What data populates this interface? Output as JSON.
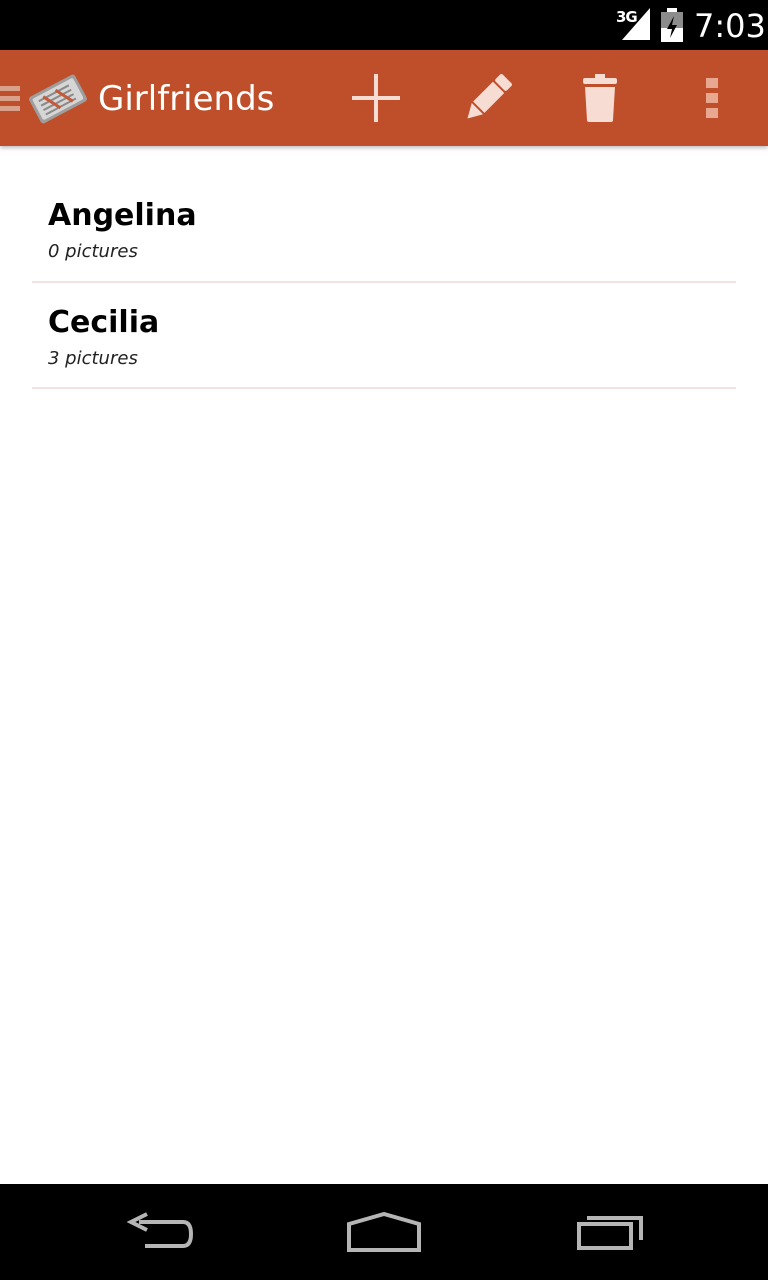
{
  "status_bar": {
    "network_label": "3G",
    "time": "7:03",
    "icons": [
      "signal-icon",
      "battery-charging-icon"
    ]
  },
  "action_bar": {
    "title": "Girlfriends",
    "background_color": "#bf4f2a",
    "icons": [
      "drawer-indicator-icon",
      "app-logo-icon",
      "add-icon",
      "edit-pencil-icon",
      "trash-icon",
      "overflow-menu-icon"
    ]
  },
  "list": {
    "items": [
      {
        "name": "Angelina",
        "subtitle": "0 pictures"
      },
      {
        "name": "Cecilia",
        "subtitle": "3 pictures"
      }
    ],
    "divider_color": "#f3e3df"
  },
  "nav_bar": {
    "icons": [
      "back-icon",
      "home-icon",
      "recents-icon"
    ]
  }
}
